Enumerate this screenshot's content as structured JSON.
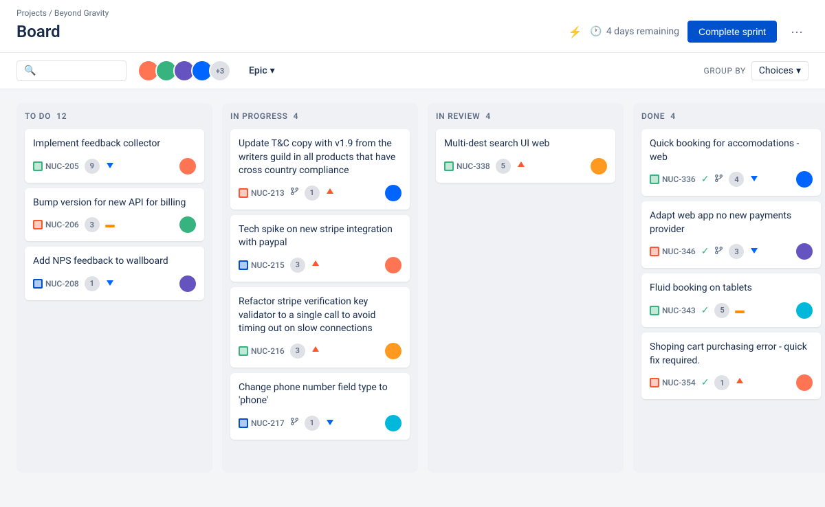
{
  "breadcrumb": "Projects / Beyond Gravity",
  "page_title": "Board",
  "header": {
    "days_remaining": "4 days remaining",
    "complete_sprint_label": "Complete sprint",
    "more_label": "···"
  },
  "toolbar": {
    "search_placeholder": "",
    "avatar_count_extra": "+3",
    "epic_label": "Epic",
    "group_by_label": "GROUP BY",
    "choices_label": "Choices"
  },
  "columns": [
    {
      "id": "todo",
      "title": "TO DO",
      "count": 12,
      "cards": [
        {
          "title": "Implement feedback collector",
          "issue_id": "NUC-205",
          "icon_type": "green",
          "points": 9,
          "priority": "low",
          "avatar_color": "av1"
        },
        {
          "title": "Bump version for new API for billing",
          "issue_id": "NUC-206",
          "icon_type": "red",
          "points": 3,
          "priority": "medium",
          "avatar_color": "av2"
        },
        {
          "title": "Add NPS feedback to wallboard",
          "issue_id": "NUC-208",
          "icon_type": "blue",
          "points": 1,
          "priority": "low",
          "avatar_color": "av3"
        }
      ]
    },
    {
      "id": "inprogress",
      "title": "IN PROGRESS",
      "count": 4,
      "cards": [
        {
          "title": "Update T&C copy with v1.9 from the writers guild in all products that have cross country compliance",
          "issue_id": "NUC-213",
          "icon_type": "red",
          "points": 1,
          "priority": "high",
          "show_merge": true,
          "avatar_color": "av4"
        },
        {
          "title": "Tech spike on new stripe integration with paypal",
          "issue_id": "NUC-215",
          "icon_type": "blue",
          "points": 3,
          "priority": "high",
          "avatar_color": "av1"
        },
        {
          "title": "Refactor stripe verification key validator to a single call to avoid timing out on slow connections",
          "issue_id": "NUC-216",
          "icon_type": "green",
          "points": 3,
          "priority": "high",
          "avatar_color": "av5"
        },
        {
          "title": "Change phone number field type to 'phone'",
          "issue_id": "NUC-217",
          "icon_type": "blue",
          "points": 1,
          "priority": "low",
          "show_merge": true,
          "avatar_color": "av6"
        }
      ]
    },
    {
      "id": "inreview",
      "title": "IN REVIEW",
      "count": 4,
      "cards": [
        {
          "title": "Multi-dest search UI web",
          "issue_id": "NUC-338",
          "icon_type": "green",
          "points": 5,
          "priority": "high",
          "avatar_color": "av5"
        }
      ]
    },
    {
      "id": "done",
      "title": "DONE",
      "count": 4,
      "cards": [
        {
          "title": "Quick booking for accomodations - web",
          "issue_id": "NUC-336",
          "icon_type": "green",
          "points": 4,
          "priority": "low",
          "show_check": true,
          "show_merge": true,
          "avatar_color": "av4"
        },
        {
          "title": "Adapt web app no new payments provider",
          "issue_id": "NUC-346",
          "icon_type": "red",
          "points": 3,
          "priority": "low",
          "show_check": true,
          "show_merge": true,
          "avatar_color": "av3"
        },
        {
          "title": "Fluid booking on tablets",
          "issue_id": "NUC-343",
          "icon_type": "green",
          "points": 5,
          "priority": "medium",
          "show_check": true,
          "avatar_color": "av6"
        },
        {
          "title": "Shoping cart purchasing error - quick fix required.",
          "issue_id": "NUC-354",
          "icon_type": "red",
          "points": 1,
          "priority": "high",
          "show_check": true,
          "avatar_color": "av1"
        }
      ]
    }
  ]
}
